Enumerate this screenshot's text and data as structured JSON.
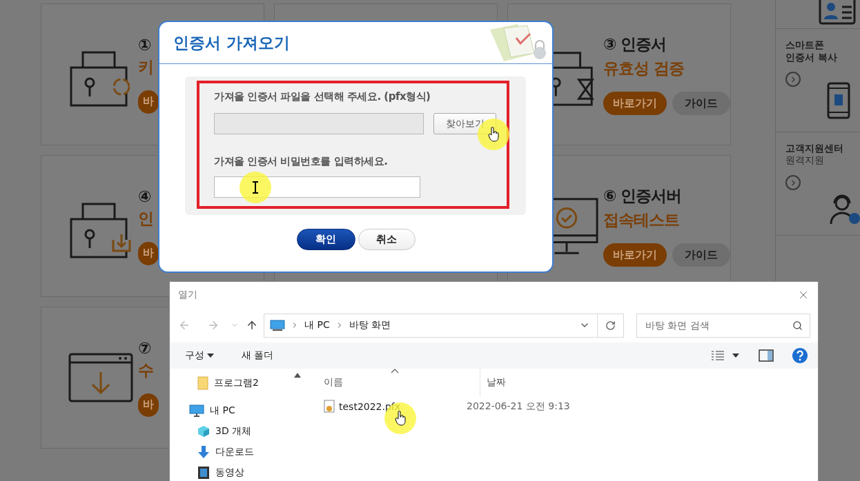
{
  "background_page": {
    "cards": [
      {
        "kind": "lock-refresh",
        "title": "①",
        "subtitle": "키",
        "buttons": [
          {
            "label": "바",
            "kind": "go"
          }
        ]
      },
      {
        "kind": "blank"
      },
      {
        "kind": "lock-hourglass",
        "title": "③ 인증서",
        "subtitle": "유효성 검증",
        "buttons": [
          {
            "label": "바로가기",
            "kind": "go"
          },
          {
            "label": "가이드",
            "kind": "guide"
          }
        ]
      },
      {
        "kind": "lock-download",
        "title": "④",
        "subtitle": "인",
        "buttons": [
          {
            "label": "바",
            "kind": "go"
          }
        ]
      },
      {
        "kind": "blank"
      },
      {
        "kind": "monitor-check",
        "title": "⑥ 인증서버",
        "subtitle": "접속테스트",
        "buttons": [
          {
            "label": "바로가기",
            "kind": "go"
          },
          {
            "label": "가이드",
            "kind": "guide"
          }
        ]
      },
      {
        "kind": "window-download",
        "title": "⑦",
        "subtitle": "수",
        "buttons": [
          {
            "label": "바",
            "kind": "go"
          }
        ]
      }
    ],
    "sidebar": [
      {
        "kind": "id-card"
      },
      {
        "kind": "phone",
        "title_lines": [
          "스마트폰",
          "인증서 복사"
        ]
      },
      {
        "kind": "support",
        "title_lines": [
          "고객지원센터"
        ],
        "subtitle": "원격지원"
      }
    ]
  },
  "cert_dialog": {
    "title": "인증서 가져오기",
    "file_label": "가져올 인증서 파일을 선택해 주세요. (pfx형식)",
    "browse_button": "찾아보기",
    "password_label": "가져올 인증서 비밀번호를 입력하세요.",
    "buttons": [
      {
        "label": "확인",
        "kind": "primary"
      },
      {
        "label": "취소",
        "kind": "secondary"
      }
    ]
  },
  "open_dialog": {
    "title": "열기",
    "path": [
      "내 PC",
      "바탕 화면"
    ],
    "search": {
      "placeholder": "바탕 화면 검색"
    },
    "toolbar": [
      {
        "label": "구성",
        "kind": "menu"
      },
      {
        "label": "새 폴더",
        "kind": "plain"
      }
    ],
    "nav": [
      {
        "label": "프로그램2",
        "kind": "folder"
      },
      {
        "label": "내 PC",
        "kind": "pc",
        "children": [
          {
            "label": "3D 개체",
            "kind": "cube"
          },
          {
            "label": "다운로드",
            "kind": "download"
          },
          {
            "label": "동영상",
            "kind": "video"
          }
        ]
      }
    ],
    "columns": [
      "이름",
      "날짜"
    ],
    "files": [
      {
        "name": "test2022.pfx",
        "date": "2022-06-21 오전 9:13"
      }
    ]
  }
}
